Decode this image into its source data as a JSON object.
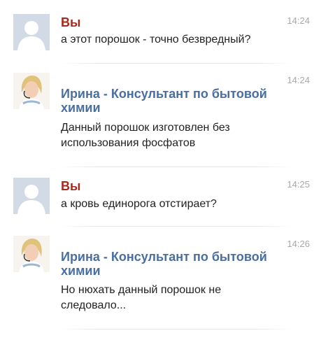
{
  "messages": [
    {
      "author": "Вы",
      "time": "14:24",
      "text": "а этот порошок - точно безвредный?",
      "avatar": "default-avatar"
    },
    {
      "author": "Ирина - Консультант по бытовой химии",
      "time": "14:24",
      "text": "Данный порошок изготовлен без использования фосфатов",
      "avatar": "consultant-avatar"
    },
    {
      "author": "Вы",
      "time": "14:25",
      "text": "а кровь единорога отстирает?",
      "avatar": "default-avatar"
    },
    {
      "author": "Ирина - Консультант по бытовой химии",
      "time": "14:26",
      "text": "Но нюхать данный порошок не следовало...",
      "avatar": "consultant-avatar"
    }
  ],
  "colors": {
    "you_name": "#a9271b",
    "consultant_name": "#4a6e9f",
    "time": "#a8a8a8",
    "text": "#222222",
    "avatar_bg": "#d0d9e3"
  }
}
